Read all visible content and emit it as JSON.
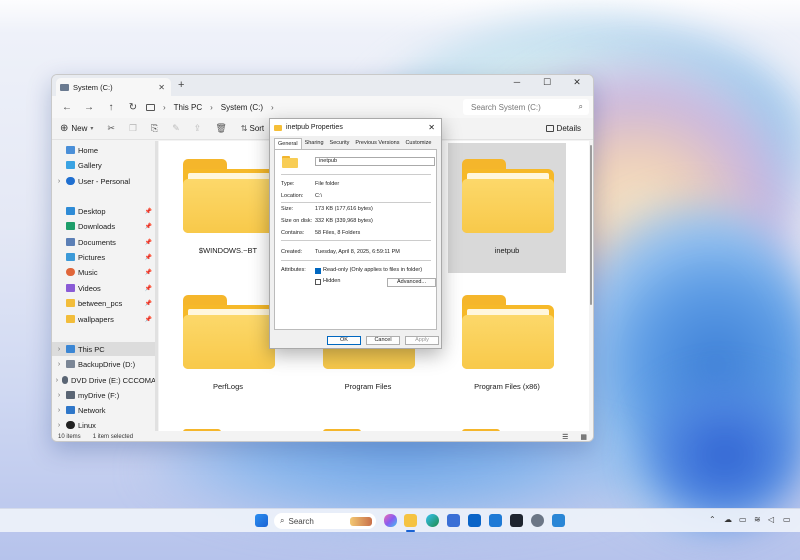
{
  "window": {
    "tab_title": "System (C:)",
    "new_tab": "+",
    "tab_close": "✕",
    "minimize": "─",
    "maximize": "☐",
    "close": "✕"
  },
  "address": {
    "back": "←",
    "forward": "→",
    "up": "↑",
    "refresh": "↻",
    "crumbs": [
      "This PC",
      "System (C:)"
    ],
    "separator": "›",
    "search_placeholder": "Search System (C:)"
  },
  "toolbar": {
    "new_label": "New",
    "sort_label": "Sort",
    "details_label": "Details"
  },
  "sidebar": {
    "items": [
      {
        "label": "Home"
      },
      {
        "label": "Gallery"
      },
      {
        "label": "User - Personal"
      },
      {
        "label": "Desktop"
      },
      {
        "label": "Downloads"
      },
      {
        "label": "Documents"
      },
      {
        "label": "Pictures"
      },
      {
        "label": "Music"
      },
      {
        "label": "Videos"
      },
      {
        "label": "between_pcs"
      },
      {
        "label": "wallpapers"
      },
      {
        "label": "This PC"
      },
      {
        "label": "BackupDrive (D:)"
      },
      {
        "label": "DVD Drive (E:) CCCOMA"
      },
      {
        "label": "myDrive (F:)"
      },
      {
        "label": "Network"
      },
      {
        "label": "Linux"
      }
    ]
  },
  "folders": [
    {
      "name": "$WINDOWS.~BT"
    },
    {
      "name": ""
    },
    {
      "name": "inetpub"
    },
    {
      "name": "PerfLogs"
    },
    {
      "name": "Program Files"
    },
    {
      "name": "Program Files (x86)"
    }
  ],
  "status": {
    "count": "10 items",
    "selected": "1 item selected"
  },
  "properties": {
    "title": "inetpub Properties",
    "close": "✕",
    "tabs": [
      "General",
      "Sharing",
      "Security",
      "Previous Versions",
      "Customize"
    ],
    "name_value": "inetpub",
    "rows": {
      "type_k": "Type:",
      "type_v": "File folder",
      "location_k": "Location:",
      "location_v": "C:\\",
      "size_k": "Size:",
      "size_v": "173 KB (177,616 bytes)",
      "disk_k": "Size on disk:",
      "disk_v": "332 KB (339,968 bytes)",
      "contains_k": "Contains:",
      "contains_v": "58 Files, 8 Folders",
      "created_k": "Created:",
      "created_v": "Tuesday, April 8, 2025, 6:59:11 PM",
      "attributes_k": "Attributes:"
    },
    "readonly_label": "Read-only (Only applies to files in folder)",
    "hidden_label": "Hidden",
    "advanced_label": "Advanced...",
    "ok_label": "OK",
    "cancel_label": "Cancel",
    "apply_label": "Apply"
  },
  "taskbar": {
    "search_label": "Search",
    "tray_chevron": "⌃"
  }
}
